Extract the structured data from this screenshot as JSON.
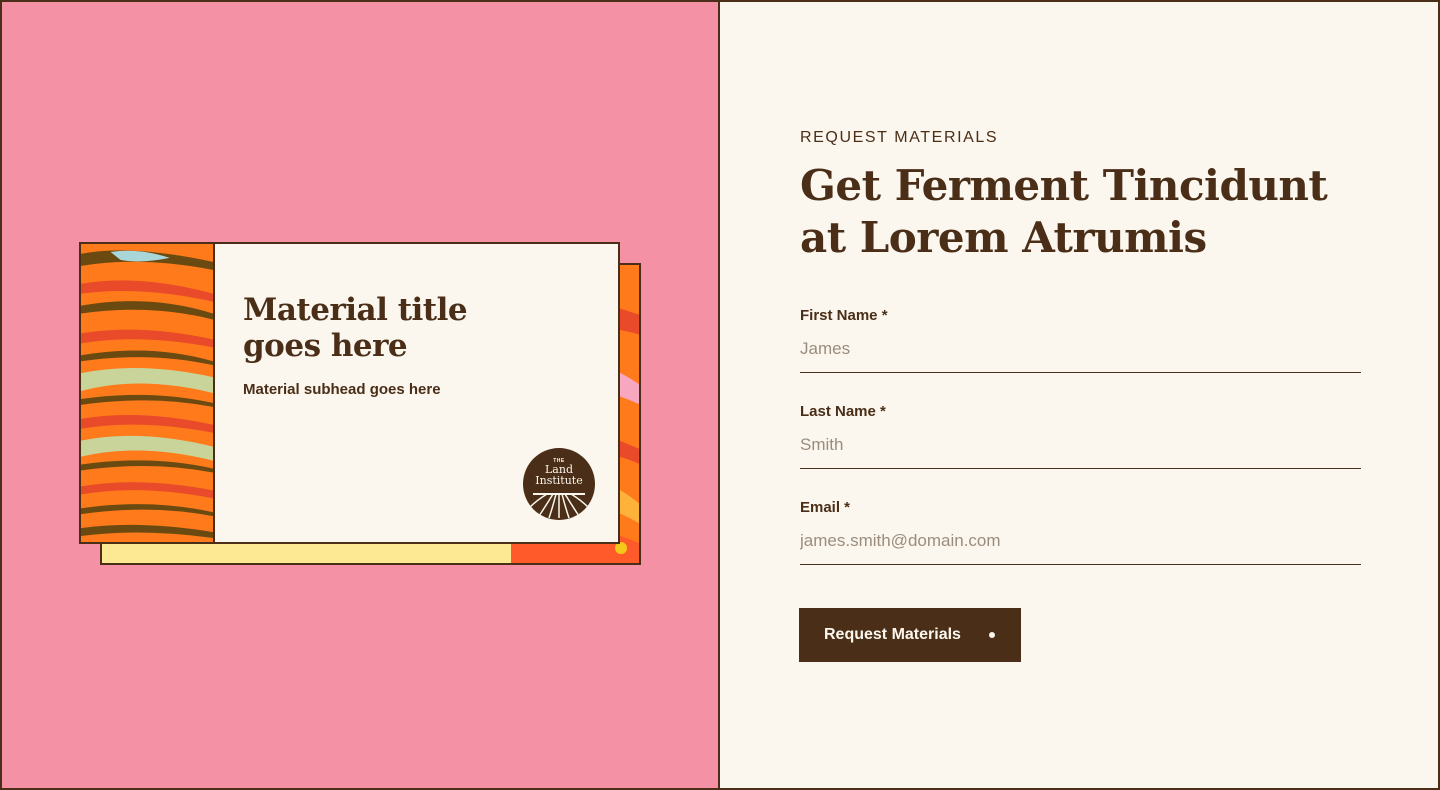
{
  "preview": {
    "card_title": "Material title goes here",
    "card_subhead": "Material subhead goes here",
    "logo": {
      "line1": "THE",
      "line2": "Land",
      "line3": "Institute"
    }
  },
  "form": {
    "eyebrow": "REQUEST MATERIALS",
    "heading": "Get Ferment Tincidunt at Lorem Atrumis",
    "fields": [
      {
        "label": "First Name *",
        "placeholder": "James"
      },
      {
        "label": "Last Name *",
        "placeholder": "Smith"
      },
      {
        "label": "Email *",
        "placeholder": "james.smith@domain.com"
      }
    ],
    "submit_label": "Request Materials"
  },
  "colors": {
    "left_bg": "#f491a4",
    "right_bg": "#fbf6ee",
    "brown": "#4a2e17",
    "card_yellow": "#fde993",
    "art_orange": "#ff7a1a"
  }
}
